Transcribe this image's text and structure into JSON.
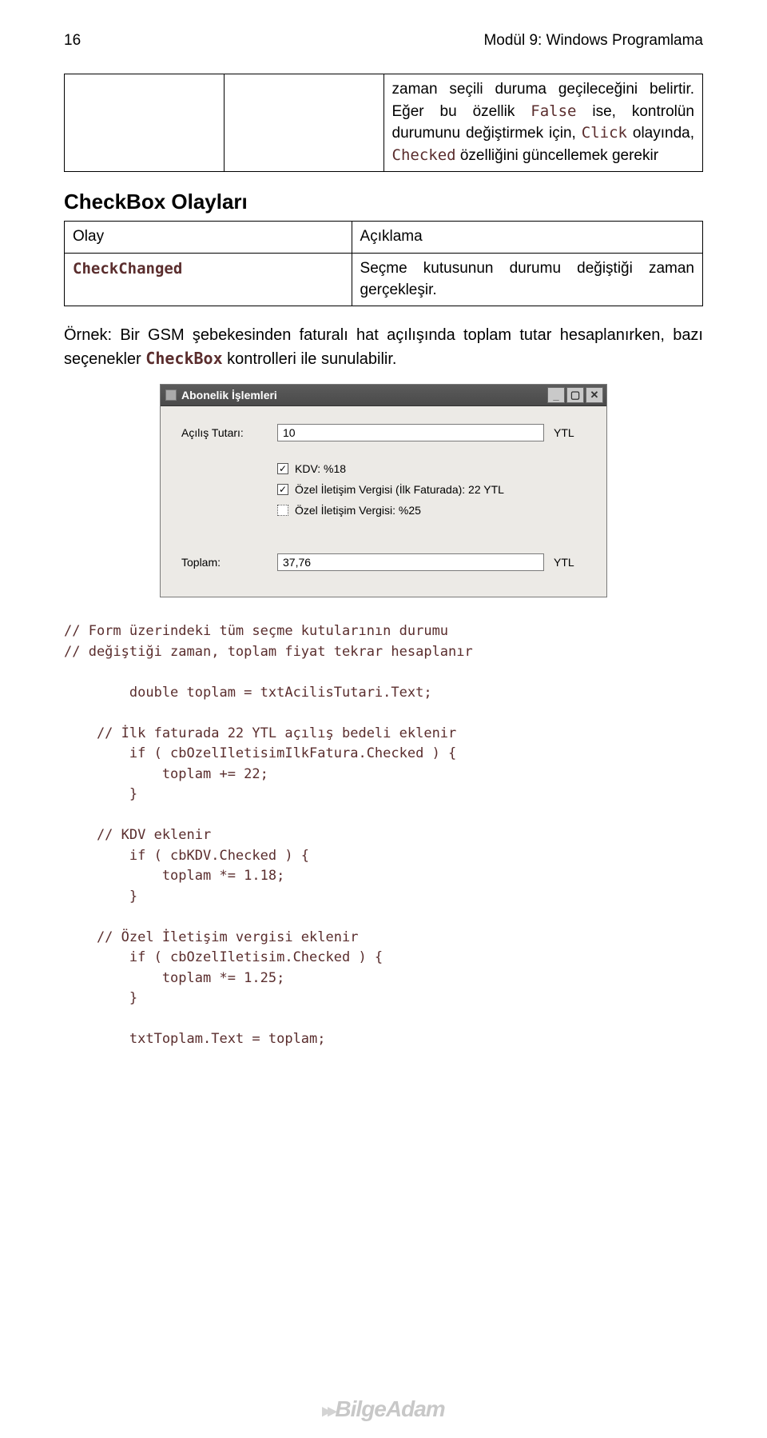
{
  "header": {
    "page_num": "16",
    "title": "Modül 9: Windows Programlama"
  },
  "property_table": {
    "text_parts": {
      "p1": "zaman seçili duruma geçileceğini belirtir. Eğer bu özellik ",
      "p2_code": "False",
      "p3": " ise, kontrolün durumunu değiştirmek için, ",
      "p4_code": "Click",
      "p5": " olayında, ",
      "p6_code": "Checked",
      "p7": " özelliğini güncellemek gerekir"
    }
  },
  "section_heading": "CheckBox Olayları",
  "event_table": {
    "h1": "Olay",
    "h2": "Açıklama",
    "r1c1_code": "CheckChanged",
    "r1c2": "Seçme kutusunun durumu değiştiği zaman gerçekleşir."
  },
  "example": {
    "parts": {
      "p1": "Örnek: Bir GSM şebekesinden faturalı hat açılışında toplam tutar hesaplanırken, bazı seçenekler ",
      "p2_code": "CheckBox",
      "p3": " kontrolleri ile sunulabilir."
    }
  },
  "winform": {
    "title": "Abonelik İşlemleri",
    "min": "_",
    "max": "▢",
    "close": "✕",
    "acilis_label": "Açılış Tutarı:",
    "acilis_value": "10",
    "unit": "YTL",
    "cb_kdv": "KDV: %18",
    "cb_ozel1": "Özel İletişim Vergisi (İlk Faturada): 22 YTL",
    "cb_ozel2": "Özel İletişim Vergisi: %25",
    "toplam_label": "Toplam:",
    "toplam_value": "37,76"
  },
  "code": "// Form üzerindeki tüm seçme kutularının durumu\n// değiştiği zaman, toplam fiyat tekrar hesaplanır\n\n        double toplam = txtAcilisTutari.Text;\n\n    // İlk faturada 22 YTL açılış bedeli eklenir\n        if ( cbOzelIletisimIlkFatura.Checked ) {\n            toplam += 22;\n        }\n\n    // KDV eklenir\n        if ( cbKDV.Checked ) {\n            toplam *= 1.18;\n        }\n\n    // Özel İletişim vergisi eklenir\n        if ( cbOzelIletisim.Checked ) {\n            toplam *= 1.25;\n        }\n\n        txtToplam.Text = toplam;",
  "footer": {
    "brand": "BilgeAdam"
  }
}
